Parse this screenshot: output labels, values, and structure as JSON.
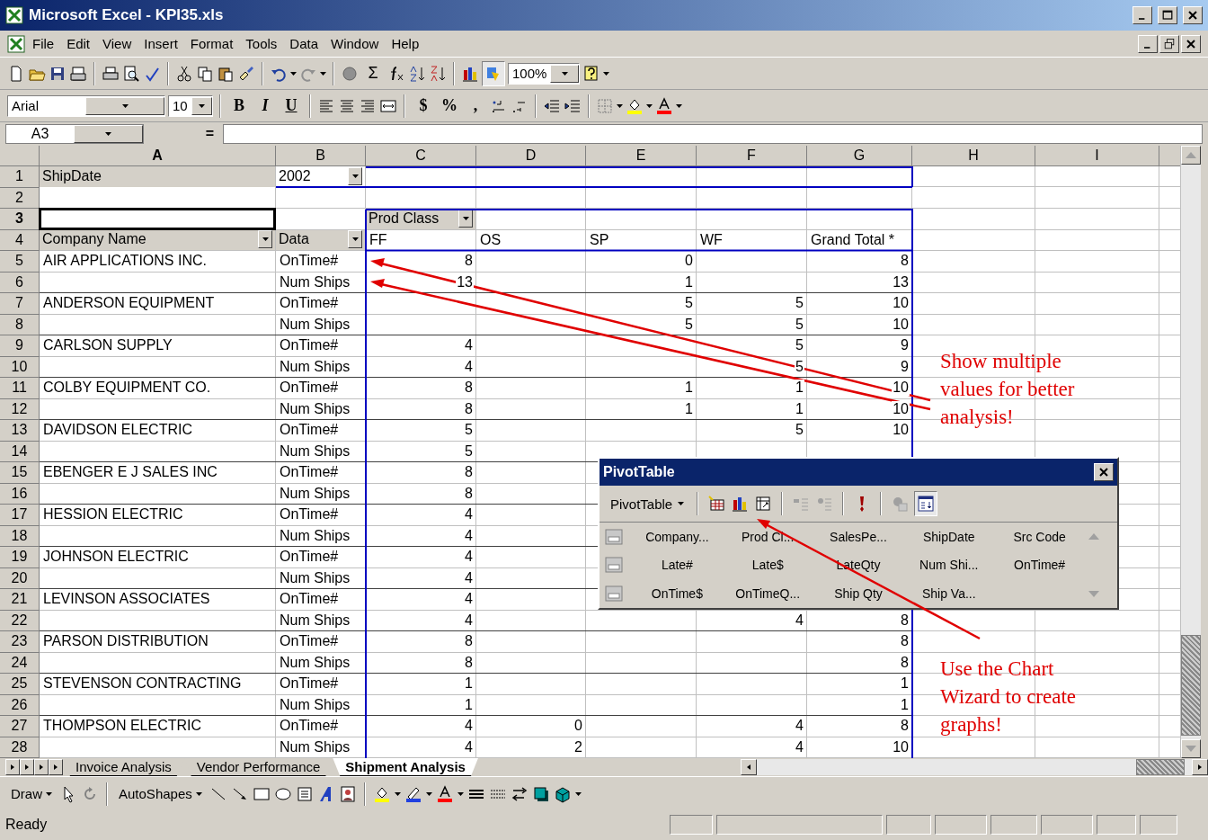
{
  "window": {
    "title": "Microsoft Excel - KPI35.xls"
  },
  "menu": [
    "File",
    "Edit",
    "View",
    "Insert",
    "Format",
    "Tools",
    "Data",
    "Window",
    "Help"
  ],
  "standard_toolbar": {
    "autosum": "Σ",
    "zoom": "100%"
  },
  "formatting_toolbar": {
    "font": "Arial",
    "size": "10",
    "bold": "B",
    "italic": "I",
    "underline": "U",
    "currency": "$",
    "percent": "%",
    "comma": ","
  },
  "formula_bar": {
    "name_box": "A3",
    "equals": "="
  },
  "columns": [
    {
      "label": "A",
      "selected": true
    },
    {
      "label": "B",
      "selected": false
    },
    {
      "label": "C",
      "selected": false
    },
    {
      "label": "D",
      "selected": false
    },
    {
      "label": "E",
      "selected": false
    },
    {
      "label": "F",
      "selected": false
    },
    {
      "label": "G",
      "selected": false
    },
    {
      "label": "H",
      "selected": false
    },
    {
      "label": "I",
      "selected": false
    }
  ],
  "rows": [
    {
      "number": "1",
      "selected": false,
      "cells": [
        {
          "kind": "field",
          "text": "ShipDate"
        },
        {
          "kind": "dropdown",
          "text": "2002"
        },
        {
          "kind": "empty"
        },
        {
          "kind": "empty"
        },
        {
          "kind": "empty"
        },
        {
          "kind": "empty"
        },
        {
          "kind": "empty"
        }
      ]
    },
    {
      "number": "2",
      "selected": false,
      "cells": [
        {
          "kind": "empty"
        },
        {
          "kind": "empty"
        },
        {
          "kind": "empty"
        },
        {
          "kind": "empty"
        },
        {
          "kind": "empty"
        },
        {
          "kind": "empty"
        },
        {
          "kind": "empty"
        }
      ]
    },
    {
      "number": "3",
      "selected": true,
      "cells": [
        {
          "kind": "active"
        },
        {
          "kind": "empty"
        },
        {
          "kind": "field-dropdown",
          "text": "Prod Class"
        },
        {
          "kind": "empty"
        },
        {
          "kind": "empty"
        },
        {
          "kind": "empty"
        },
        {
          "kind": "empty"
        }
      ]
    },
    {
      "number": "4",
      "selected": false,
      "cells": [
        {
          "kind": "field-dropdown",
          "text": "Company Name"
        },
        {
          "kind": "field-dropdown",
          "text": "Data"
        },
        {
          "kind": "text",
          "text": "FF"
        },
        {
          "kind": "text",
          "text": "OS"
        },
        {
          "kind": "text",
          "text": "SP"
        },
        {
          "kind": "text",
          "text": "WF"
        },
        {
          "kind": "text",
          "text": "Grand Total *"
        }
      ]
    },
    {
      "number": "5",
      "selected": false,
      "cells": [
        {
          "kind": "text",
          "text": "AIR APPLICATIONS INC."
        },
        {
          "kind": "text",
          "text": "OnTime#"
        },
        {
          "kind": "number",
          "text": "8"
        },
        {
          "kind": "empty"
        },
        {
          "kind": "number",
          "text": "0"
        },
        {
          "kind": "empty"
        },
        {
          "kind": "number",
          "text": "8"
        }
      ]
    },
    {
      "number": "6",
      "selected": false,
      "cells": [
        {
          "kind": "empty"
        },
        {
          "kind": "text",
          "text": "Num Ships"
        },
        {
          "kind": "number",
          "text": "13"
        },
        {
          "kind": "empty"
        },
        {
          "kind": "number",
          "text": "1"
        },
        {
          "kind": "empty"
        },
        {
          "kind": "number",
          "text": "13"
        }
      ]
    },
    {
      "number": "7",
      "selected": false,
      "cells": [
        {
          "kind": "text",
          "text": "ANDERSON EQUIPMENT"
        },
        {
          "kind": "text",
          "text": "OnTime#"
        },
        {
          "kind": "empty"
        },
        {
          "kind": "empty"
        },
        {
          "kind": "number",
          "text": "5"
        },
        {
          "kind": "number",
          "text": "5"
        },
        {
          "kind": "number",
          "text": "10"
        }
      ]
    },
    {
      "number": "8",
      "selected": false,
      "cells": [
        {
          "kind": "empty"
        },
        {
          "kind": "text",
          "text": "Num Ships"
        },
        {
          "kind": "empty"
        },
        {
          "kind": "empty"
        },
        {
          "kind": "number",
          "text": "5"
        },
        {
          "kind": "number",
          "text": "5"
        },
        {
          "kind": "number",
          "text": "10"
        }
      ]
    },
    {
      "number": "9",
      "selected": false,
      "cells": [
        {
          "kind": "text",
          "text": "CARLSON SUPPLY"
        },
        {
          "kind": "text",
          "text": "OnTime#"
        },
        {
          "kind": "number",
          "text": "4"
        },
        {
          "kind": "empty"
        },
        {
          "kind": "empty"
        },
        {
          "kind": "number",
          "text": "5"
        },
        {
          "kind": "number",
          "text": "9"
        }
      ]
    },
    {
      "number": "10",
      "selected": false,
      "cells": [
        {
          "kind": "empty"
        },
        {
          "kind": "text",
          "text": "Num Ships"
        },
        {
          "kind": "number",
          "text": "4"
        },
        {
          "kind": "empty"
        },
        {
          "kind": "empty"
        },
        {
          "kind": "number",
          "text": "5"
        },
        {
          "kind": "number",
          "text": "9"
        }
      ]
    },
    {
      "number": "11",
      "selected": false,
      "cells": [
        {
          "kind": "text",
          "text": "COLBY EQUIPMENT CO."
        },
        {
          "kind": "text",
          "text": "OnTime#"
        },
        {
          "kind": "number",
          "text": "8"
        },
        {
          "kind": "empty"
        },
        {
          "kind": "number",
          "text": "1"
        },
        {
          "kind": "number",
          "text": "1"
        },
        {
          "kind": "number",
          "text": "10"
        }
      ]
    },
    {
      "number": "12",
      "selected": false,
      "cells": [
        {
          "kind": "empty"
        },
        {
          "kind": "text",
          "text": "Num Ships"
        },
        {
          "kind": "number",
          "text": "8"
        },
        {
          "kind": "empty"
        },
        {
          "kind": "number",
          "text": "1"
        },
        {
          "kind": "number",
          "text": "1"
        },
        {
          "kind": "number",
          "text": "10"
        }
      ]
    },
    {
      "number": "13",
      "selected": false,
      "cells": [
        {
          "kind": "text",
          "text": "DAVIDSON ELECTRIC"
        },
        {
          "kind": "text",
          "text": "OnTime#"
        },
        {
          "kind": "number",
          "text": "5"
        },
        {
          "kind": "empty"
        },
        {
          "kind": "empty"
        },
        {
          "kind": "number",
          "text": "5"
        },
        {
          "kind": "number",
          "text": "10"
        }
      ]
    },
    {
      "number": "14",
      "selected": false,
      "cells": [
        {
          "kind": "empty"
        },
        {
          "kind": "text",
          "text": "Num Ships"
        },
        {
          "kind": "number",
          "text": "5"
        },
        {
          "kind": "empty"
        },
        {
          "kind": "empty"
        },
        {
          "kind": "empty"
        },
        {
          "kind": "empty"
        }
      ]
    },
    {
      "number": "15",
      "selected": false,
      "cells": [
        {
          "kind": "text",
          "text": "EBENGER E J SALES INC"
        },
        {
          "kind": "text",
          "text": "OnTime#"
        },
        {
          "kind": "number",
          "text": "8"
        },
        {
          "kind": "empty"
        },
        {
          "kind": "empty"
        },
        {
          "kind": "empty"
        },
        {
          "kind": "empty"
        }
      ]
    },
    {
      "number": "16",
      "selected": false,
      "cells": [
        {
          "kind": "empty"
        },
        {
          "kind": "text",
          "text": "Num Ships"
        },
        {
          "kind": "number",
          "text": "8"
        },
        {
          "kind": "empty"
        },
        {
          "kind": "empty"
        },
        {
          "kind": "empty"
        },
        {
          "kind": "empty"
        }
      ]
    },
    {
      "number": "17",
      "selected": false,
      "cells": [
        {
          "kind": "text",
          "text": "HESSION ELECTRIC"
        },
        {
          "kind": "text",
          "text": "OnTime#"
        },
        {
          "kind": "number",
          "text": "4"
        },
        {
          "kind": "empty"
        },
        {
          "kind": "empty"
        },
        {
          "kind": "empty"
        },
        {
          "kind": "empty"
        }
      ]
    },
    {
      "number": "18",
      "selected": false,
      "cells": [
        {
          "kind": "empty"
        },
        {
          "kind": "text",
          "text": "Num Ships"
        },
        {
          "kind": "number",
          "text": "4"
        },
        {
          "kind": "empty"
        },
        {
          "kind": "empty"
        },
        {
          "kind": "empty"
        },
        {
          "kind": "empty"
        }
      ]
    },
    {
      "number": "19",
      "selected": false,
      "cells": [
        {
          "kind": "text",
          "text": "JOHNSON ELECTRIC"
        },
        {
          "kind": "text",
          "text": "OnTime#"
        },
        {
          "kind": "number",
          "text": "4"
        },
        {
          "kind": "empty"
        },
        {
          "kind": "empty"
        },
        {
          "kind": "empty"
        },
        {
          "kind": "empty"
        }
      ]
    },
    {
      "number": "20",
      "selected": false,
      "cells": [
        {
          "kind": "empty"
        },
        {
          "kind": "text",
          "text": "Num Ships"
        },
        {
          "kind": "number",
          "text": "4"
        },
        {
          "kind": "empty"
        },
        {
          "kind": "empty"
        },
        {
          "kind": "empty"
        },
        {
          "kind": "empty"
        }
      ]
    },
    {
      "number": "21",
      "selected": false,
      "cells": [
        {
          "kind": "text",
          "text": "LEVINSON ASSOCIATES"
        },
        {
          "kind": "text",
          "text": "OnTime#"
        },
        {
          "kind": "number",
          "text": "4"
        },
        {
          "kind": "empty"
        },
        {
          "kind": "empty"
        },
        {
          "kind": "empty"
        },
        {
          "kind": "empty"
        }
      ]
    },
    {
      "number": "22",
      "selected": false,
      "cells": [
        {
          "kind": "empty"
        },
        {
          "kind": "text",
          "text": "Num Ships"
        },
        {
          "kind": "number",
          "text": "4"
        },
        {
          "kind": "empty"
        },
        {
          "kind": "empty"
        },
        {
          "kind": "number",
          "text": "4"
        },
        {
          "kind": "number",
          "text": "8"
        }
      ]
    },
    {
      "number": "23",
      "selected": false,
      "cells": [
        {
          "kind": "text",
          "text": "PARSON DISTRIBUTION"
        },
        {
          "kind": "text",
          "text": "OnTime#"
        },
        {
          "kind": "number",
          "text": "8"
        },
        {
          "kind": "empty"
        },
        {
          "kind": "empty"
        },
        {
          "kind": "empty"
        },
        {
          "kind": "number",
          "text": "8"
        }
      ]
    },
    {
      "number": "24",
      "selected": false,
      "cells": [
        {
          "kind": "empty"
        },
        {
          "kind": "text",
          "text": "Num Ships"
        },
        {
          "kind": "number",
          "text": "8"
        },
        {
          "kind": "empty"
        },
        {
          "kind": "empty"
        },
        {
          "kind": "empty"
        },
        {
          "kind": "number",
          "text": "8"
        }
      ]
    },
    {
      "number": "25",
      "selected": false,
      "cells": [
        {
          "kind": "text",
          "text": "STEVENSON CONTRACTING"
        },
        {
          "kind": "text",
          "text": "OnTime#"
        },
        {
          "kind": "number",
          "text": "1"
        },
        {
          "kind": "empty"
        },
        {
          "kind": "empty"
        },
        {
          "kind": "empty"
        },
        {
          "kind": "number",
          "text": "1"
        }
      ]
    },
    {
      "number": "26",
      "selected": false,
      "cells": [
        {
          "kind": "empty"
        },
        {
          "kind": "text",
          "text": "Num Ships"
        },
        {
          "kind": "number",
          "text": "1"
        },
        {
          "kind": "empty"
        },
        {
          "kind": "empty"
        },
        {
          "kind": "empty"
        },
        {
          "kind": "number",
          "text": "1"
        }
      ]
    },
    {
      "number": "27",
      "selected": false,
      "cells": [
        {
          "kind": "text",
          "text": "THOMPSON ELECTRIC"
        },
        {
          "kind": "text",
          "text": "OnTime#"
        },
        {
          "kind": "number",
          "text": "4"
        },
        {
          "kind": "number",
          "text": "0"
        },
        {
          "kind": "empty"
        },
        {
          "kind": "number",
          "text": "4"
        },
        {
          "kind": "number",
          "text": "8"
        }
      ]
    },
    {
      "number": "28",
      "selected": false,
      "cells": [
        {
          "kind": "empty"
        },
        {
          "kind": "text",
          "text": "Num Ships"
        },
        {
          "kind": "number",
          "text": "4"
        },
        {
          "kind": "number",
          "text": "2"
        },
        {
          "kind": "empty"
        },
        {
          "kind": "number",
          "text": "4"
        },
        {
          "kind": "number",
          "text": "10"
        }
      ]
    }
  ],
  "sheet_tabs": [
    {
      "label": "Invoice Analysis",
      "selected": false
    },
    {
      "label": "Vendor Performance",
      "selected": false
    },
    {
      "label": "Shipment Analysis",
      "selected": true
    }
  ],
  "pivot_window": {
    "title": "PivotTable",
    "menu": "PivotTable",
    "fields": [
      "Company...",
      "Prod Cl...",
      "SalesPe...",
      "ShipDate",
      "Src Code",
      "Late#",
      "Late$",
      "LateQty",
      "Num Shi...",
      "OnTime#",
      "OnTime$",
      "OnTimeQ...",
      "Ship Qty",
      "Ship Va..."
    ]
  },
  "drawing_toolbar": {
    "draw": "Draw",
    "autoshapes": "AutoShapes"
  },
  "annotations": [
    "Show multiple values for better analysis!",
    "Use the Chart Wizard to create graphs!"
  ],
  "status_bar": {
    "text": "Ready"
  }
}
